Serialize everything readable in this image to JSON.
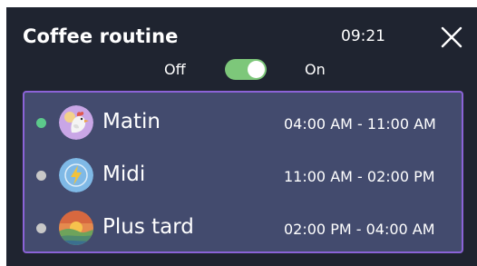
{
  "header": {
    "title": "Coffee routine",
    "time": "09:21"
  },
  "toggle": {
    "off_label": "Off",
    "on_label": "On",
    "state": "on"
  },
  "colors": {
    "panel": "#1f2430",
    "list_bg": "#434b6e",
    "list_border": "#8b63d7",
    "toggle_on": "#7dc77a",
    "active_dot": "#5cc98b",
    "inactive_dot": "#c8c8c8"
  },
  "schedule": [
    {
      "name": "Matin",
      "range": "04:00 AM - 11:00 AM",
      "active": true,
      "icon": "rooster-icon"
    },
    {
      "name": "Midi",
      "range": "11:00 AM - 02:00 PM",
      "active": false,
      "icon": "lightning-clock-icon"
    },
    {
      "name": "Plus tard",
      "range": "02:00 PM - 04:00 AM",
      "active": false,
      "icon": "sunset-landscape-icon"
    }
  ]
}
